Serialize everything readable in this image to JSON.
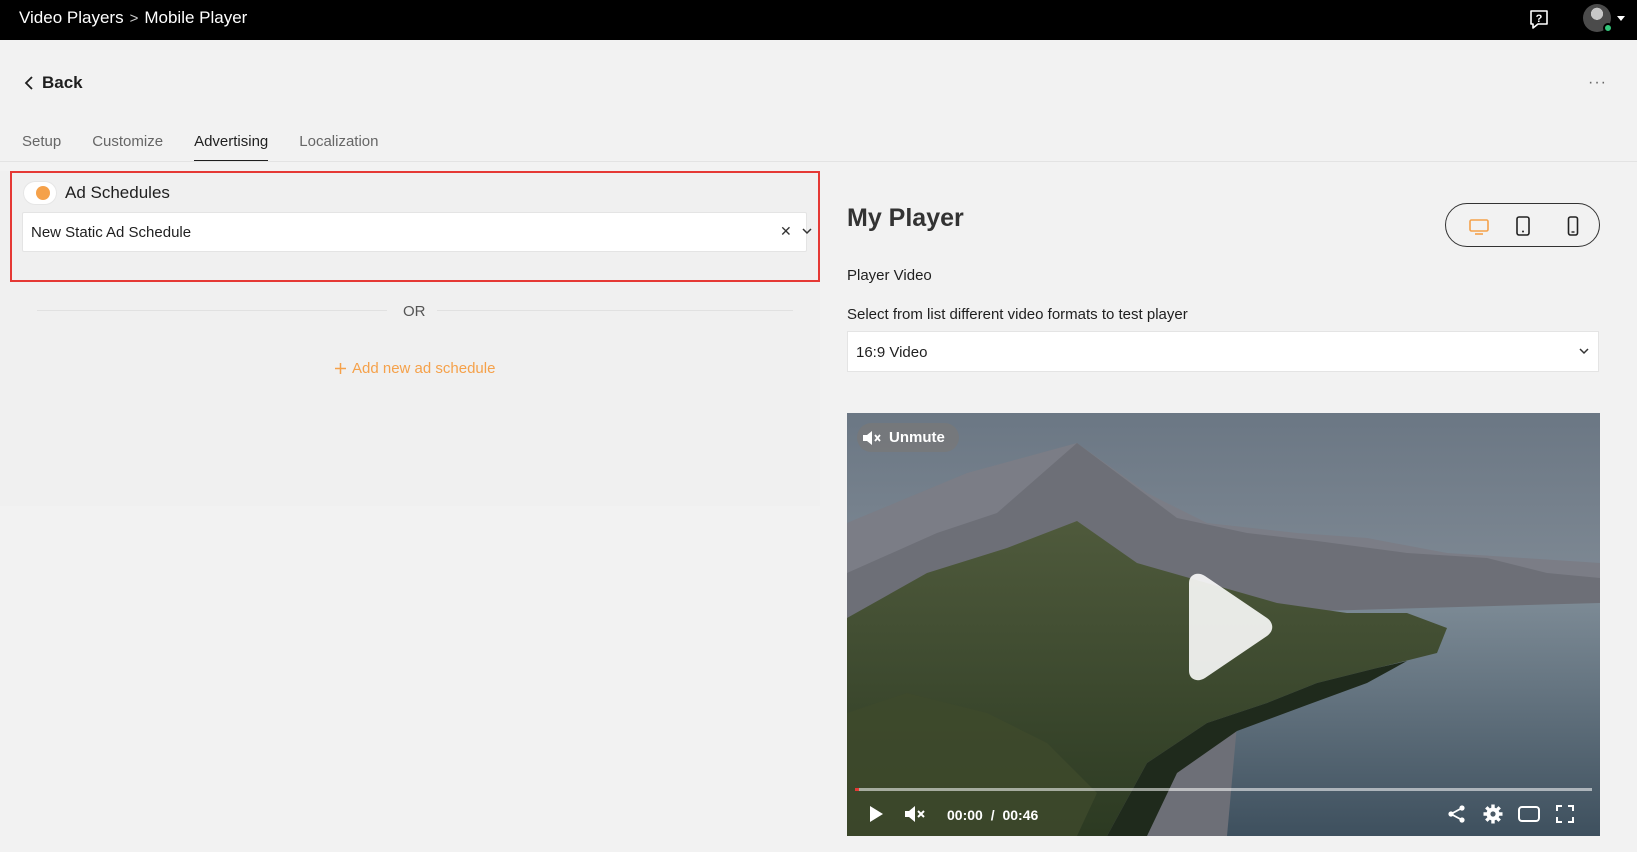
{
  "breadcrumb": {
    "parent": "Video Players",
    "separator": ">",
    "current": "Mobile Player"
  },
  "header": {
    "help_icon": "help-chat-icon",
    "avatar": "user-avatar",
    "status_color": "#34c77b"
  },
  "nav": {
    "back_label": "Back",
    "more_label": "···"
  },
  "tabs": [
    {
      "label": "Setup",
      "active": false
    },
    {
      "label": "Customize",
      "active": false
    },
    {
      "label": "Advertising",
      "active": true
    },
    {
      "label": "Localization",
      "active": false
    }
  ],
  "ads": {
    "toggle_label": "Ad Schedules",
    "toggle_on": true,
    "selected_schedule": "New Static Ad Schedule",
    "or_label": "OR",
    "add_label": "Add new ad schedule",
    "accent": "#f5a14a",
    "highlight_color": "#e53935"
  },
  "preview": {
    "title": "My Player",
    "devices": [
      "desktop-icon",
      "tablet-icon",
      "mobile-icon"
    ],
    "active_device": "desktop-icon",
    "player_video_label": "Player Video",
    "format_help": "Select from list different video formats to test player",
    "format_value": "16:9 Video"
  },
  "video": {
    "unmute_label": "Unmute",
    "current_time": "00:00",
    "time_sep": "/",
    "duration": "00:46",
    "progress": 0.005
  }
}
